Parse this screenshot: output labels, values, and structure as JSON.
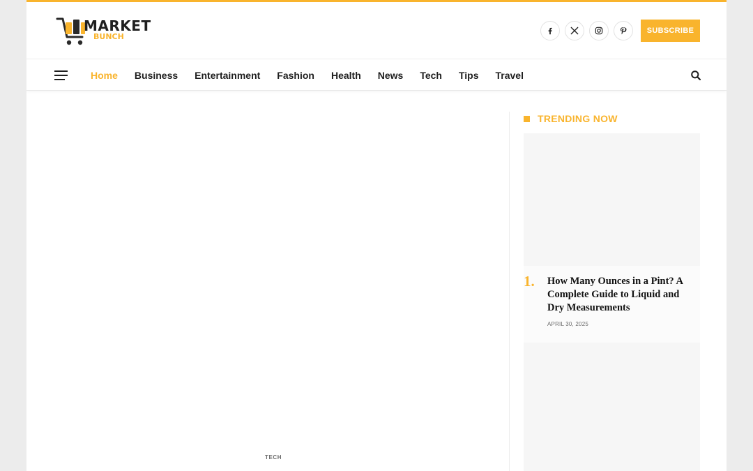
{
  "brand": {
    "logo_word_main": "MARKET",
    "logo_word_sub": "BUNCH",
    "accent_color": "#f9b42d"
  },
  "header": {
    "socials": [
      {
        "name": "facebook-icon"
      },
      {
        "name": "x-twitter-icon"
      },
      {
        "name": "instagram-icon"
      },
      {
        "name": "pinterest-icon"
      }
    ],
    "subscribe_label": "SUBSCRIBE"
  },
  "nav": {
    "items": [
      {
        "label": "Home",
        "active": true
      },
      {
        "label": "Business"
      },
      {
        "label": "Entertainment"
      },
      {
        "label": "Fashion"
      },
      {
        "label": "Health"
      },
      {
        "label": "News"
      },
      {
        "label": "Tech"
      },
      {
        "label": "Tips"
      },
      {
        "label": "Travel"
      }
    ],
    "menu_icon": "hamburger-icon",
    "search_icon": "search-icon"
  },
  "main": {
    "category": "TECH"
  },
  "sidebar": {
    "trending_title": "TRENDING NOW",
    "posts": [
      {
        "number": "1.",
        "title": "How Many Ounces in a Pint? A Complete Guide to Liquid and Dry Measurements",
        "date": "APRIL 30, 2025"
      }
    ]
  }
}
